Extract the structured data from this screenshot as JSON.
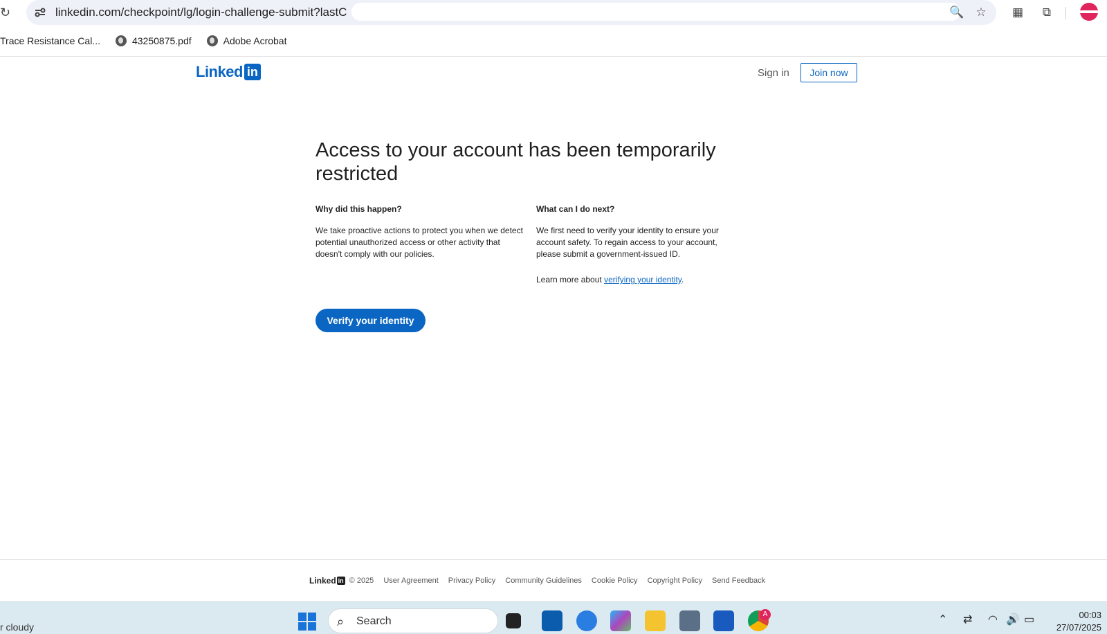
{
  "browser": {
    "url": "linkedin.com/checkpoint/lg/login-challenge-submit?lastC",
    "bookmarks": [
      "Trace Resistance Cal...",
      "43250875.pdf",
      "Adobe Acrobat"
    ]
  },
  "header": {
    "logo_word": "Linked",
    "logo_box": "in",
    "sign_in": "Sign in",
    "join_now": "Join now"
  },
  "main": {
    "title": "Access to your account has been temporarily restricted",
    "left": {
      "heading": "Why did this happen?",
      "body": "We take proactive actions to protect you when we detect potential unauthorized access or other activity that doesn't comply with our policies."
    },
    "right": {
      "heading": "What can I do next?",
      "body": "We first need to verify your identity to ensure your account safety. To regain access to your account, please submit a government-issued ID.",
      "learn_prefix": "Learn more about ",
      "learn_link": "verifying your identity",
      "learn_suffix": "."
    },
    "verify_button": "Verify your identity"
  },
  "footer": {
    "logo_word": "Linked",
    "logo_box": "in",
    "copyright": "© 2025",
    "links": [
      "User Agreement",
      "Privacy Policy",
      "Community Guidelines",
      "Cookie Policy",
      "Copyright Policy",
      "Send Feedback"
    ]
  },
  "taskbar": {
    "weather": "r cloudy",
    "search_label": "Search",
    "time": "00:03",
    "date": "27/07/2025",
    "chrome_badge": "A"
  },
  "colors": {
    "brand": "#0a66c2",
    "taskbar": "#dbe9f1"
  }
}
